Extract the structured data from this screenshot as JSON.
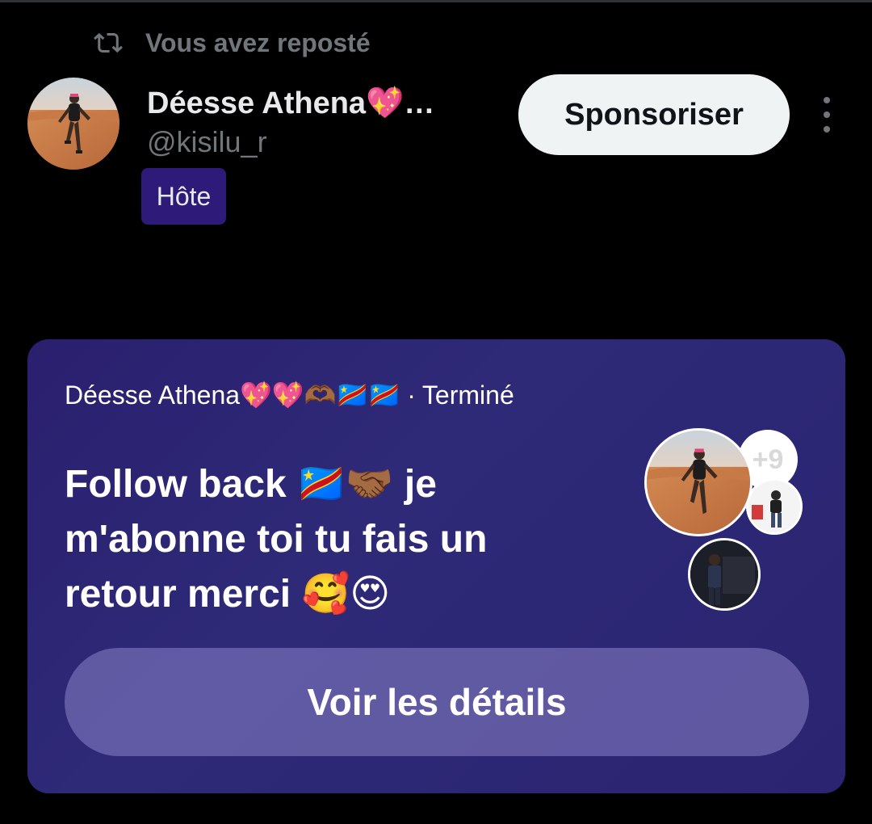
{
  "repost": {
    "icon": "repost-icon",
    "text": "Vous avez reposté"
  },
  "author": {
    "display_name": "Déesse Athena💖…",
    "handle": "@kisilu_r",
    "role_badge": "Hôte",
    "avatar": "avatar-desert-photo"
  },
  "actions": {
    "sponsor_label": "Sponsoriser",
    "more_icon": "more-vertical-icon"
  },
  "space": {
    "host_name": "Déesse Athena💖💖🫶🏾🇨🇩🇨🇩",
    "separator": "·",
    "status": "Terminé",
    "title_line1": "Follow back 🇨🇩🤝🏾 je",
    "title_line2": "m'abonne toi tu fais un",
    "title_line3": "retour merci 🥰😍",
    "participants_more": "+9",
    "details_label": "Voir les détails"
  },
  "colors": {
    "background": "#000000",
    "card_gradient_start": "#2a1f6e",
    "card_gradient_end": "#2b2470",
    "badge": "#2e1a78",
    "muted_text": "#71767b",
    "primary_text": "#e7e9ea"
  }
}
